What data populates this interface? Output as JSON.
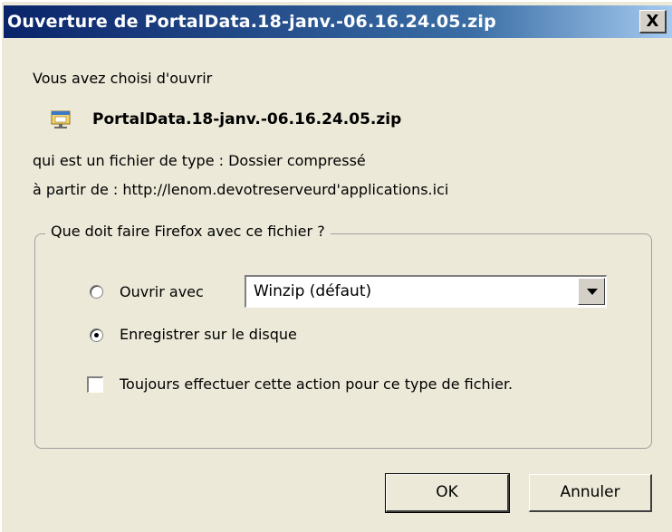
{
  "window": {
    "title": "Ouverture de PortalData.18-janv.-06.16.24.05.zip",
    "close_label": "X"
  },
  "body": {
    "intro": "Vous avez choisi d'ouvrir",
    "filename": "PortalData.18-janv.-06.16.24.05.zip",
    "file_type": "qui est un fichier de type :  Dossier compressé",
    "source": "à partir de :  http://lenom.devotreserveurd'applications.ici"
  },
  "group": {
    "legend": "Que doit faire Firefox avec ce fichier ?",
    "open_with_label": "Ouvrir avec",
    "open_with_value": "Winzip (défaut)",
    "save_label": "Enregistrer sur le disque",
    "always_label": "Toujours effectuer cette action pour ce type de fichier.",
    "selected_option": "save",
    "always_checked": false
  },
  "buttons": {
    "ok_label": "OK",
    "cancel_label": "Annuler"
  },
  "icons": {
    "file": "zip-file-icon",
    "close": "close-icon",
    "dropdown": "chevron-down-icon"
  }
}
